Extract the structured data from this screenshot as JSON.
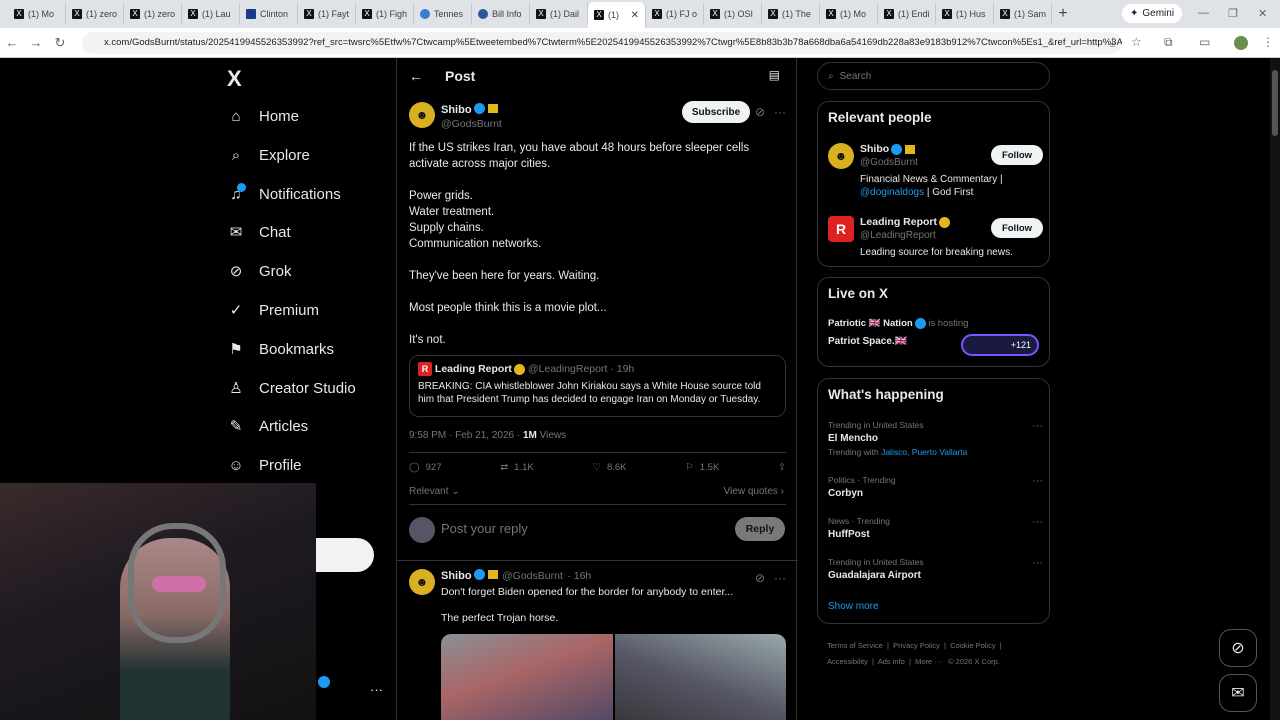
{
  "browser": {
    "tabs": [
      {
        "label": "(1) Mo"
      },
      {
        "label": "(1) zero"
      },
      {
        "label": "(1) zero"
      },
      {
        "label": "(1) Lau"
      },
      {
        "label": "Clinton"
      },
      {
        "label": "(1) Fayt"
      },
      {
        "label": "(1) Figh"
      },
      {
        "label": "Tennes"
      },
      {
        "label": "Bill Info"
      },
      {
        "label": "(1) Dail"
      },
      {
        "label": "(1)"
      },
      {
        "label": "(1) FJ o"
      },
      {
        "label": "(1) OSI"
      },
      {
        "label": "(1) The"
      },
      {
        "label": "(1) Mo"
      },
      {
        "label": "(1) Endi"
      },
      {
        "label": "(1) Hus"
      },
      {
        "label": "(1) Sam"
      }
    ],
    "gemini_label": "Gemini",
    "url": "x.com/GodsBurnt/status/2025419945526353992?ref_src=twsrc%5Etfw%7Ctwcamp%5Etweetembed%7Ctwterm%5E2025419945526353992%7Ctwgr%5E8b83b3b78a668dba6a54169db228a83e9183b912%7Ctwcon%5Es1_&ref_url=http%3A%2..."
  },
  "nav": {
    "logo": "X",
    "items": [
      {
        "label": "Home",
        "icon": "home-icon"
      },
      {
        "label": "Explore",
        "icon": "search-icon"
      },
      {
        "label": "Notifications",
        "icon": "bell-icon"
      },
      {
        "label": "Chat",
        "icon": "mail-icon"
      },
      {
        "label": "Grok",
        "icon": "grok-icon"
      },
      {
        "label": "Premium",
        "icon": "verified-icon"
      },
      {
        "label": "Bookmarks",
        "icon": "bookmark-icon"
      },
      {
        "label": "Creator Studio",
        "icon": "creator-icon"
      },
      {
        "label": "Articles",
        "icon": "article-icon"
      },
      {
        "label": "Profile",
        "icon": "person-icon"
      }
    ]
  },
  "post": {
    "header_title": "Post",
    "author_name": "Shibo",
    "author_handle": "@GodsBurnt",
    "subscribe_label": "Subscribe",
    "paragraphs": [
      "If the US strikes Iran, you have about 48 hours before sleeper cells activate across major cities.",
      "Power grids.\nWater treatment.\nSupply chains.\nCommunication networks.",
      "They've been here for years. Waiting.",
      "Most people think this is a movie plot...",
      "It's not."
    ],
    "quote": {
      "name": "Leading Report",
      "handle": "@LeadingReport",
      "time": "· 19h",
      "text": "BREAKING: CIA whistleblower John Kiriakou says a White House source told him that President Trump has decided to engage Iran on Monday or Tuesday."
    },
    "timestamp": "9:58 PM · Feb 21, 2026 · ",
    "views_count": "1M",
    "views_label": " Views",
    "stats": {
      "replies": "927",
      "reposts": "1.1K",
      "likes": "8.6K",
      "bookmarks": "1.5K"
    },
    "relevant_label": "Relevant",
    "view_quotes_label": "View quotes",
    "reply_placeholder": "Post your reply",
    "reply_button": "Reply"
  },
  "reply": {
    "name": "Shibo",
    "handle": "@GodsBurnt",
    "time": "· 16h",
    "line1": "Don't forget Biden opened for the border for anybody to enter...",
    "line2": "The perfect Trojan horse."
  },
  "sidebar": {
    "search_placeholder": "Search",
    "relevant_title": "Relevant people",
    "people": [
      {
        "name": "Shibo",
        "handle": "@GodsBurnt",
        "bio_a": "Financial News & Commentary |",
        "bio_link": "@doginaldogs",
        "bio_b": " | God First",
        "follow": "Follow"
      },
      {
        "name": "Leading Report",
        "handle": "@LeadingReport",
        "bio": "Leading source for breaking news.",
        "follow": "Follow"
      }
    ],
    "live_title": "Live on X",
    "live_host": "Patriotic 🇬🇧 Nation",
    "live_hosting": " is hosting",
    "live_space": "Patriot Space.🇬🇧",
    "live_count": "+121",
    "happening_title": "What's happening",
    "trends": [
      {
        "context": "Trending in United States",
        "name": "El Mencho",
        "with_label": "Trending with ",
        "with": "Jalisco, Puerto Vallarta"
      },
      {
        "context": "Politics · Trending",
        "name": "Corbyn"
      },
      {
        "context": "News · Trending",
        "name": "HuffPost"
      },
      {
        "context": "Trending in United States",
        "name": "Guadalajara Airport"
      }
    ],
    "show_more": "Show more",
    "footer": [
      "Terms of Service",
      "Privacy Policy",
      "Cookie Policy",
      "Accessibility",
      "Ads info",
      "More ···",
      "© 2026 X Corp."
    ]
  },
  "colors": {
    "accent": "#1d9bf0",
    "background": "#000000",
    "border": "#2f3336",
    "muted": "#71767b"
  }
}
